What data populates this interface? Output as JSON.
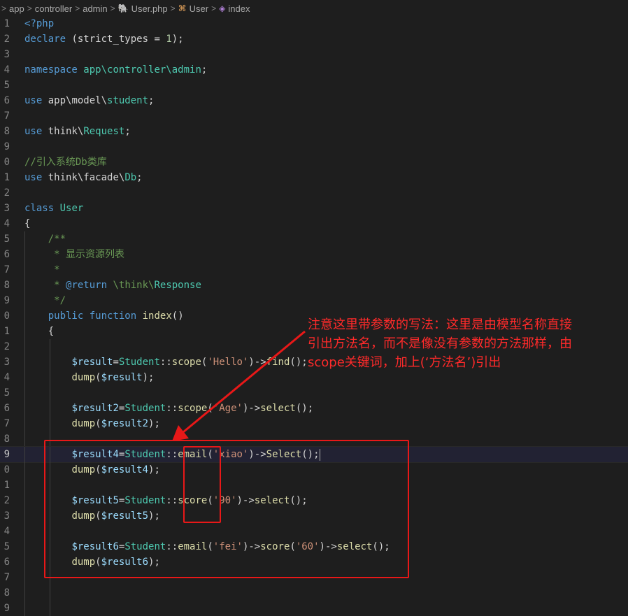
{
  "breadcrumb": {
    "items": [
      "app",
      "controller",
      "admin",
      "User.php",
      "User",
      "index"
    ],
    "separator": ">"
  },
  "code_lines": [
    {
      "n": "1",
      "indent": 0,
      "tokens": [
        [
          "<?php",
          "kw"
        ]
      ]
    },
    {
      "n": "2",
      "indent": 0,
      "tokens": [
        [
          "declare",
          "kw"
        ],
        [
          " (strict_types = ",
          "pl"
        ],
        [
          "1",
          "num"
        ],
        [
          ");",
          "pl"
        ]
      ]
    },
    {
      "n": "3",
      "indent": 0,
      "tokens": []
    },
    {
      "n": "4",
      "indent": 0,
      "tokens": [
        [
          "namespace",
          "kw"
        ],
        [
          " ",
          "pl"
        ],
        [
          "app\\controller\\admin",
          "ns"
        ],
        [
          ";",
          "pl"
        ]
      ]
    },
    {
      "n": "5",
      "indent": 0,
      "tokens": []
    },
    {
      "n": "6",
      "indent": 0,
      "tokens": [
        [
          "use",
          "kw"
        ],
        [
          " app\\model\\",
          "pl"
        ],
        [
          "student",
          "ns"
        ],
        [
          ";",
          "pl"
        ]
      ]
    },
    {
      "n": "7",
      "indent": 0,
      "tokens": []
    },
    {
      "n": "8",
      "indent": 0,
      "tokens": [
        [
          "use",
          "kw"
        ],
        [
          " think\\",
          "pl"
        ],
        [
          "Request",
          "ns"
        ],
        [
          ";",
          "pl"
        ]
      ]
    },
    {
      "n": "9",
      "indent": 0,
      "tokens": []
    },
    {
      "n": "0",
      "indent": 0,
      "tokens": [
        [
          "//引入系统Db类库",
          "cm"
        ]
      ]
    },
    {
      "n": "1",
      "indent": 0,
      "tokens": [
        [
          "use",
          "kw"
        ],
        [
          " think\\facade\\",
          "pl"
        ],
        [
          "Db",
          "ns"
        ],
        [
          ";",
          "pl"
        ]
      ]
    },
    {
      "n": "2",
      "indent": 0,
      "tokens": []
    },
    {
      "n": "3",
      "indent": 0,
      "tokens": [
        [
          "class",
          "kw"
        ],
        [
          " ",
          "pl"
        ],
        [
          "User",
          "ns"
        ]
      ]
    },
    {
      "n": "4",
      "indent": 0,
      "tokens": [
        [
          "{",
          "pl"
        ]
      ]
    },
    {
      "n": "5",
      "indent": 1,
      "tokens": [
        [
          "    /**",
          "cm"
        ]
      ]
    },
    {
      "n": "6",
      "indent": 1,
      "tokens": [
        [
          "     * 显示资源列表",
          "cm"
        ]
      ]
    },
    {
      "n": "7",
      "indent": 1,
      "tokens": [
        [
          "     *",
          "cm"
        ]
      ]
    },
    {
      "n": "8",
      "indent": 1,
      "tokens": [
        [
          "     * ",
          "cm"
        ],
        [
          "@return",
          "kw"
        ],
        [
          " \\think\\",
          "cm"
        ],
        [
          "Response",
          "ns"
        ]
      ]
    },
    {
      "n": "9",
      "indent": 1,
      "tokens": [
        [
          "     */",
          "cm"
        ]
      ]
    },
    {
      "n": "0",
      "indent": 1,
      "tokens": [
        [
          "    ",
          "pl"
        ],
        [
          "public",
          "kw"
        ],
        [
          " ",
          "pl"
        ],
        [
          "function",
          "kw"
        ],
        [
          " ",
          "pl"
        ],
        [
          "index",
          "fn"
        ],
        [
          "()",
          "pl"
        ]
      ]
    },
    {
      "n": "1",
      "indent": 1,
      "tokens": [
        [
          "    {",
          "pl"
        ]
      ]
    },
    {
      "n": "2",
      "indent": 2,
      "tokens": []
    },
    {
      "n": "3",
      "indent": 2,
      "tokens": [
        [
          "        ",
          "pl"
        ],
        [
          "$result",
          "var"
        ],
        [
          "=",
          "pl"
        ],
        [
          "Student",
          "ns"
        ],
        [
          "::",
          "pl"
        ],
        [
          "scope",
          "fn"
        ],
        [
          "(",
          "pl"
        ],
        [
          "'Hello'",
          "str"
        ],
        [
          ")->",
          "pl"
        ],
        [
          "find",
          "fn"
        ],
        [
          "();",
          "pl"
        ]
      ]
    },
    {
      "n": "4",
      "indent": 2,
      "tokens": [
        [
          "        ",
          "pl"
        ],
        [
          "dump",
          "fn"
        ],
        [
          "(",
          "pl"
        ],
        [
          "$result",
          "var"
        ],
        [
          ");",
          "pl"
        ]
      ]
    },
    {
      "n": "5",
      "indent": 2,
      "tokens": []
    },
    {
      "n": "6",
      "indent": 2,
      "tokens": [
        [
          "        ",
          "pl"
        ],
        [
          "$result2",
          "var"
        ],
        [
          "=",
          "pl"
        ],
        [
          "Student",
          "ns"
        ],
        [
          "::",
          "pl"
        ],
        [
          "scope",
          "fn"
        ],
        [
          "(",
          "pl"
        ],
        [
          "'Age'",
          "str"
        ],
        [
          ")->",
          "pl"
        ],
        [
          "select",
          "fn"
        ],
        [
          "();",
          "pl"
        ]
      ]
    },
    {
      "n": "7",
      "indent": 2,
      "tokens": [
        [
          "        ",
          "pl"
        ],
        [
          "dump",
          "fn"
        ],
        [
          "(",
          "pl"
        ],
        [
          "$result2",
          "var"
        ],
        [
          ");",
          "pl"
        ]
      ]
    },
    {
      "n": "8",
      "indent": 2,
      "tokens": []
    },
    {
      "n": "9",
      "indent": 2,
      "active": true,
      "tokens": [
        [
          "        ",
          "pl"
        ],
        [
          "$result4",
          "var"
        ],
        [
          "=",
          "pl"
        ],
        [
          "Student",
          "ns"
        ],
        [
          "::",
          "pl"
        ],
        [
          "email",
          "fn"
        ],
        [
          "(",
          "pl"
        ],
        [
          "'xiao'",
          "str"
        ],
        [
          ")->",
          "pl"
        ],
        [
          "Select",
          "fn"
        ],
        [
          "();",
          "pl"
        ]
      ]
    },
    {
      "n": "0",
      "indent": 2,
      "tokens": [
        [
          "        ",
          "pl"
        ],
        [
          "dump",
          "fn"
        ],
        [
          "(",
          "pl"
        ],
        [
          "$result4",
          "var"
        ],
        [
          ");",
          "pl"
        ]
      ]
    },
    {
      "n": "1",
      "indent": 2,
      "tokens": []
    },
    {
      "n": "2",
      "indent": 2,
      "tokens": [
        [
          "        ",
          "pl"
        ],
        [
          "$result5",
          "var"
        ],
        [
          "=",
          "pl"
        ],
        [
          "Student",
          "ns"
        ],
        [
          "::",
          "pl"
        ],
        [
          "score",
          "fn"
        ],
        [
          "(",
          "pl"
        ],
        [
          "'90'",
          "str"
        ],
        [
          ")->",
          "pl"
        ],
        [
          "select",
          "fn"
        ],
        [
          "();",
          "pl"
        ]
      ]
    },
    {
      "n": "3",
      "indent": 2,
      "tokens": [
        [
          "        ",
          "pl"
        ],
        [
          "dump",
          "fn"
        ],
        [
          "(",
          "pl"
        ],
        [
          "$result5",
          "var"
        ],
        [
          ");",
          "pl"
        ]
      ]
    },
    {
      "n": "4",
      "indent": 2,
      "tokens": []
    },
    {
      "n": "5",
      "indent": 2,
      "tokens": [
        [
          "        ",
          "pl"
        ],
        [
          "$result6",
          "var"
        ],
        [
          "=",
          "pl"
        ],
        [
          "Student",
          "ns"
        ],
        [
          "::",
          "pl"
        ],
        [
          "email",
          "fn"
        ],
        [
          "(",
          "pl"
        ],
        [
          "'fei'",
          "str"
        ],
        [
          ")->",
          "pl"
        ],
        [
          "score",
          "fn"
        ],
        [
          "(",
          "pl"
        ],
        [
          "'60'",
          "str"
        ],
        [
          ")->",
          "pl"
        ],
        [
          "select",
          "fn"
        ],
        [
          "();",
          "pl"
        ]
      ]
    },
    {
      "n": "6",
      "indent": 2,
      "tokens": [
        [
          "        ",
          "pl"
        ],
        [
          "dump",
          "fn"
        ],
        [
          "(",
          "pl"
        ],
        [
          "$result6",
          "var"
        ],
        [
          ");",
          "pl"
        ]
      ]
    },
    {
      "n": "7",
      "indent": 2,
      "tokens": []
    },
    {
      "n": "8",
      "indent": 2,
      "tokens": []
    },
    {
      "n": "9",
      "indent": 2,
      "tokens": []
    }
  ],
  "annotation": {
    "lines": [
      "注意这里带参数的写法：这里是由模型名称直接",
      "引出方法名，而不是像没有参数的方法那样，由",
      "scope关键词，加上(‘方法名’)引出"
    ],
    "color": "#ff2a2a"
  },
  "colors": {
    "background": "#1e1e1e",
    "keyword": "#569cd6",
    "class": "#4ec9b0",
    "comment": "#6a9955",
    "variable": "#9cdcfe",
    "function": "#dcdcaa",
    "string": "#ce9178",
    "annotation_red": "#e81818"
  }
}
